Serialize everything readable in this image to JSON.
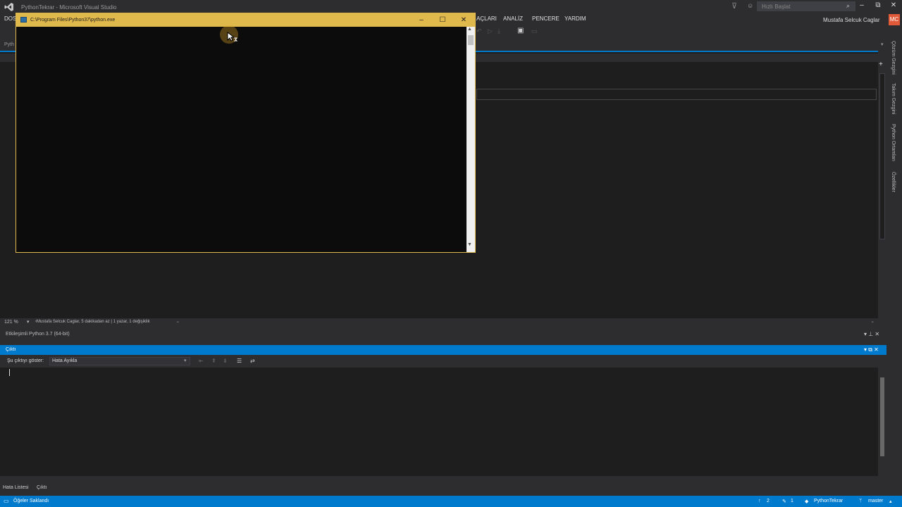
{
  "window": {
    "title": "PythonTekrar - Microsoft Visual Studio",
    "quick_launch_placeholder": "Hızlı Başlat",
    "user_name": "Mustafa Selcuk Caglar",
    "user_initials": "MC"
  },
  "menu": {
    "items": [
      "DOS",
      "AÇLARI",
      "ANALİZ",
      "PENCERE",
      "YARDIM"
    ]
  },
  "editor": {
    "tab_partial": "Pyth",
    "zoom": "121 %",
    "codelens": "Mustafa Selcuk Caglar, 5 dakikadan az | 1 yazar, 1 değişiklik"
  },
  "right_sidebar": {
    "tabs": [
      "Çözüm Gezgini",
      "Takım Gezgini",
      "Python Ortamları",
      "Özellikler"
    ]
  },
  "interactive": {
    "title": "Etkileşimli Python 3.7 (64-bit)"
  },
  "output": {
    "title": "Çıktı",
    "show_label": "Şu çıktıyı göster:",
    "source_value": "Hata Ayıkla"
  },
  "bottom_tabs": [
    "Hata Listesi",
    "Çıktı"
  ],
  "statusbar": {
    "message": "Öğeler Saklandı",
    "up_count": "2",
    "edit_count": "1",
    "repo": "PythonTekrar",
    "branch": "master"
  },
  "console": {
    "title": "C:\\Program Files\\Python37\\python.exe"
  },
  "colors": {
    "accent": "#007acc",
    "console_titlebar": "#e0b94c",
    "user_badge": "#e05a3a"
  }
}
